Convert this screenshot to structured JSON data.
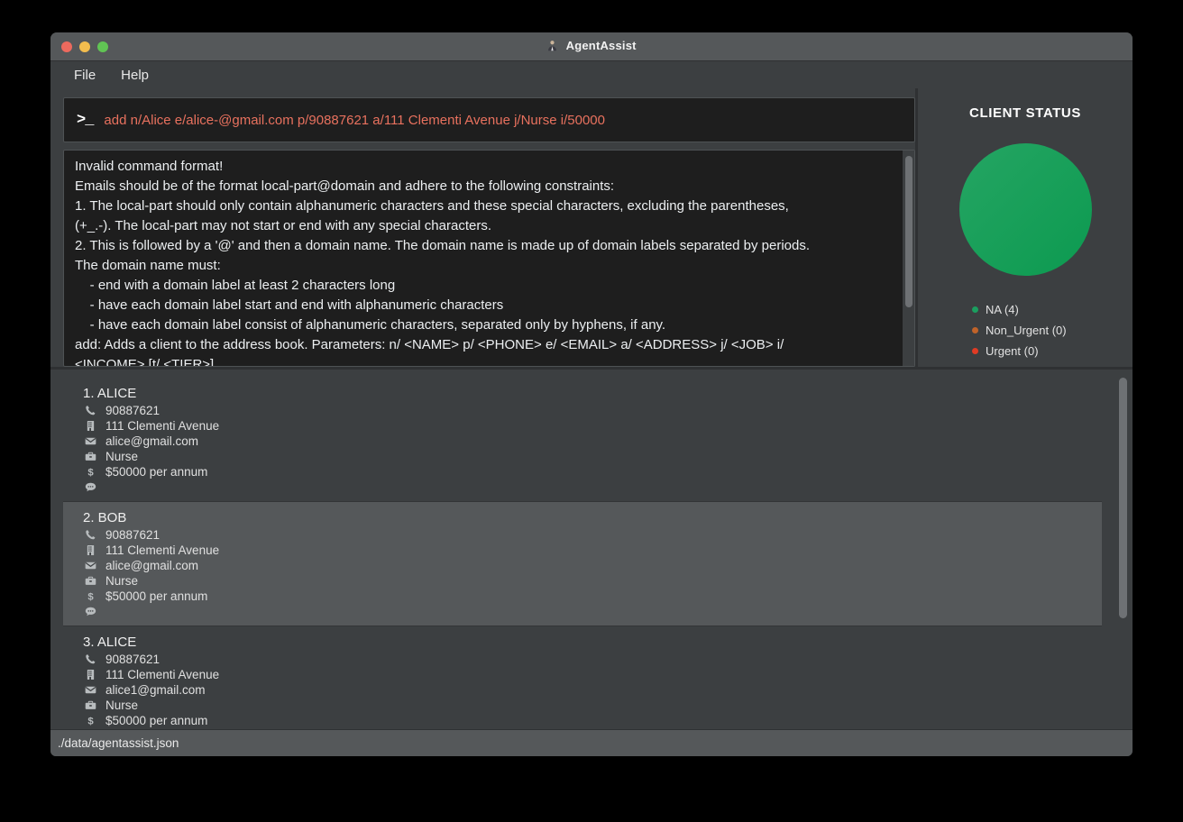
{
  "window": {
    "title": "AgentAssist",
    "app_icon": "agent-person-icon",
    "traffic_lights": [
      "close",
      "minimize",
      "maximize"
    ]
  },
  "menubar": {
    "items": [
      {
        "label": "File"
      },
      {
        "label": "Help"
      }
    ]
  },
  "command": {
    "prompt": ">_",
    "value": "add n/Alice e/alice-@gmail.com p/90887621 a/111 Clementi Avenue j/Nurse i/50000",
    "text_color": "#e8715e"
  },
  "result": {
    "lines": [
      "Invalid command format!",
      "Emails should be of the format local-part@domain and adhere to the following constraints:",
      "1. The local-part should only contain alphanumeric characters and these special characters, excluding the parentheses,",
      "(+_.-). The local-part may not start or end with any special characters.",
      "2. This is followed by a '@' and then a domain name. The domain name is made up of domain labels separated by periods.",
      "The domain name must:",
      "    - end with a domain label at least 2 characters long",
      "    - have each domain label start and end with alphanumeric characters",
      "    - have each domain label consist of alphanumeric characters, separated only by hyphens, if any.",
      "add: Adds a client to the address book. Parameters: n/ <NAME> p/ <PHONE> e/ <EMAIL> a/ <ADDRESS> j/ <JOB> i/",
      "<INCOME> [t/ <TIER>]"
    ]
  },
  "status_panel": {
    "title": "CLIENT STATUS",
    "chart_data": {
      "type": "pie",
      "title": "CLIENT STATUS",
      "categories": [
        "NA",
        "Non_Urgent",
        "Urgent"
      ],
      "values": [
        4,
        0,
        0
      ],
      "colors": [
        "#1b9e5f",
        "#c0632a",
        "#e03b24"
      ],
      "legend_labels": [
        "NA (4)",
        "Non_Urgent (0)",
        "Urgent (0)"
      ],
      "legend_position": "bottom-left",
      "total": 4
    },
    "legend": [
      {
        "label": "NA (4)",
        "color": "#1b9e5f"
      },
      {
        "label": "Non_Urgent (0)",
        "color": "#c0632a"
      },
      {
        "label": "Urgent (0)",
        "color": "#e03b24"
      }
    ]
  },
  "client_list": {
    "cards": [
      {
        "title": "1. ALICE",
        "selected": false,
        "phone": "90887621",
        "address": "111 Clementi Avenue",
        "email": "alice@gmail.com",
        "job": "Nurse",
        "income": "$50000 per annum",
        "remark": ""
      },
      {
        "title": "2. BOB",
        "selected": true,
        "phone": "90887621",
        "address": "111 Clementi Avenue",
        "email": "alice@gmail.com",
        "job": "Nurse",
        "income": "$50000 per annum",
        "remark": ""
      },
      {
        "title": "3. ALICE",
        "selected": false,
        "phone": "90887621",
        "address": "111 Clementi Avenue",
        "email": "alice1@gmail.com",
        "job": "Nurse",
        "income": "$50000 per annum",
        "remark": ""
      }
    ],
    "field_icons": {
      "phone": "phone-icon",
      "address": "building-icon",
      "email": "envelope-icon",
      "job": "briefcase-icon",
      "income": "dollar-icon",
      "remark": "speech-bubble-icon"
    }
  },
  "statusbar": {
    "file_path": "./data/agentassist.json"
  }
}
